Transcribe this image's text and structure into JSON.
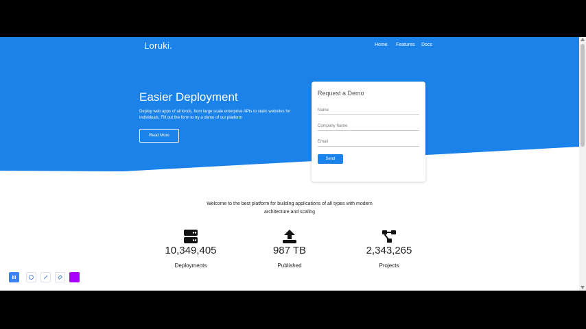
{
  "nav": {
    "brand": "Loruki.",
    "links": [
      "Home",
      "Features",
      "Docs"
    ]
  },
  "hero": {
    "title": "Easier Deployment",
    "text": "Deploy web apps of all kinds, from large scale enterprise APIs to static websites for individuals. Fill out the form to try a demo of our platform",
    "button": "Read More"
  },
  "form": {
    "title": "Request a Demo",
    "fields": [
      {
        "placeholder": "Name"
      },
      {
        "placeholder": "Company Name"
      },
      {
        "placeholder": "Email"
      }
    ],
    "button": "Send"
  },
  "welcome": "Welcome to the best platform for building applications of all types with modern architecture and scaling",
  "stats": [
    {
      "icon": "server-icon",
      "value": "10,349,405",
      "label": "Deployments"
    },
    {
      "icon": "upload-icon",
      "value": "987 TB",
      "label": "Published"
    },
    {
      "icon": "project-diagram-icon",
      "value": "2,343,265",
      "label": "Projects"
    }
  ],
  "colors": {
    "primary": "#1a82e8",
    "white": "#ffffff",
    "text": "#222222",
    "tool_active": "#3b82f6",
    "tool_purple": "#aa00ff"
  }
}
